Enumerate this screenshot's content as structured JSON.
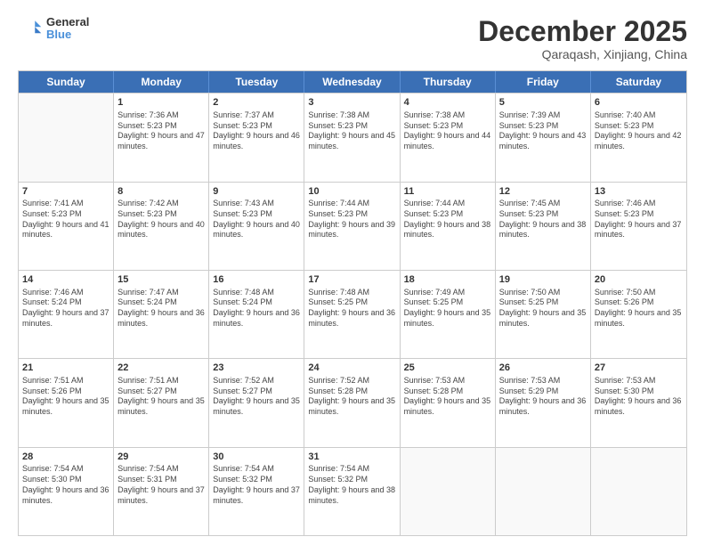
{
  "header": {
    "logo_line1": "General",
    "logo_line2": "Blue",
    "month": "December 2025",
    "location": "Qaraqash, Xinjiang, China"
  },
  "days_of_week": [
    "Sunday",
    "Monday",
    "Tuesday",
    "Wednesday",
    "Thursday",
    "Friday",
    "Saturday"
  ],
  "weeks": [
    [
      {
        "day": "",
        "empty": true
      },
      {
        "day": "1",
        "sunrise": "7:36 AM",
        "sunset": "5:23 PM",
        "daylight": "9 hours and 47 minutes."
      },
      {
        "day": "2",
        "sunrise": "7:37 AM",
        "sunset": "5:23 PM",
        "daylight": "9 hours and 46 minutes."
      },
      {
        "day": "3",
        "sunrise": "7:38 AM",
        "sunset": "5:23 PM",
        "daylight": "9 hours and 45 minutes."
      },
      {
        "day": "4",
        "sunrise": "7:38 AM",
        "sunset": "5:23 PM",
        "daylight": "9 hours and 44 minutes."
      },
      {
        "day": "5",
        "sunrise": "7:39 AM",
        "sunset": "5:23 PM",
        "daylight": "9 hours and 43 minutes."
      },
      {
        "day": "6",
        "sunrise": "7:40 AM",
        "sunset": "5:23 PM",
        "daylight": "9 hours and 42 minutes."
      }
    ],
    [
      {
        "day": "7",
        "sunrise": "7:41 AM",
        "sunset": "5:23 PM",
        "daylight": "9 hours and 41 minutes."
      },
      {
        "day": "8",
        "sunrise": "7:42 AM",
        "sunset": "5:23 PM",
        "daylight": "9 hours and 40 minutes."
      },
      {
        "day": "9",
        "sunrise": "7:43 AM",
        "sunset": "5:23 PM",
        "daylight": "9 hours and 40 minutes."
      },
      {
        "day": "10",
        "sunrise": "7:44 AM",
        "sunset": "5:23 PM",
        "daylight": "9 hours and 39 minutes."
      },
      {
        "day": "11",
        "sunrise": "7:44 AM",
        "sunset": "5:23 PM",
        "daylight": "9 hours and 38 minutes."
      },
      {
        "day": "12",
        "sunrise": "7:45 AM",
        "sunset": "5:23 PM",
        "daylight": "9 hours and 38 minutes."
      },
      {
        "day": "13",
        "sunrise": "7:46 AM",
        "sunset": "5:23 PM",
        "daylight": "9 hours and 37 minutes."
      }
    ],
    [
      {
        "day": "14",
        "sunrise": "7:46 AM",
        "sunset": "5:24 PM",
        "daylight": "9 hours and 37 minutes."
      },
      {
        "day": "15",
        "sunrise": "7:47 AM",
        "sunset": "5:24 PM",
        "daylight": "9 hours and 36 minutes."
      },
      {
        "day": "16",
        "sunrise": "7:48 AM",
        "sunset": "5:24 PM",
        "daylight": "9 hours and 36 minutes."
      },
      {
        "day": "17",
        "sunrise": "7:48 AM",
        "sunset": "5:25 PM",
        "daylight": "9 hours and 36 minutes."
      },
      {
        "day": "18",
        "sunrise": "7:49 AM",
        "sunset": "5:25 PM",
        "daylight": "9 hours and 35 minutes."
      },
      {
        "day": "19",
        "sunrise": "7:50 AM",
        "sunset": "5:25 PM",
        "daylight": "9 hours and 35 minutes."
      },
      {
        "day": "20",
        "sunrise": "7:50 AM",
        "sunset": "5:26 PM",
        "daylight": "9 hours and 35 minutes."
      }
    ],
    [
      {
        "day": "21",
        "sunrise": "7:51 AM",
        "sunset": "5:26 PM",
        "daylight": "9 hours and 35 minutes."
      },
      {
        "day": "22",
        "sunrise": "7:51 AM",
        "sunset": "5:27 PM",
        "daylight": "9 hours and 35 minutes."
      },
      {
        "day": "23",
        "sunrise": "7:52 AM",
        "sunset": "5:27 PM",
        "daylight": "9 hours and 35 minutes."
      },
      {
        "day": "24",
        "sunrise": "7:52 AM",
        "sunset": "5:28 PM",
        "daylight": "9 hours and 35 minutes."
      },
      {
        "day": "25",
        "sunrise": "7:53 AM",
        "sunset": "5:28 PM",
        "daylight": "9 hours and 35 minutes."
      },
      {
        "day": "26",
        "sunrise": "7:53 AM",
        "sunset": "5:29 PM",
        "daylight": "9 hours and 36 minutes."
      },
      {
        "day": "27",
        "sunrise": "7:53 AM",
        "sunset": "5:30 PM",
        "daylight": "9 hours and 36 minutes."
      }
    ],
    [
      {
        "day": "28",
        "sunrise": "7:54 AM",
        "sunset": "5:30 PM",
        "daylight": "9 hours and 36 minutes."
      },
      {
        "day": "29",
        "sunrise": "7:54 AM",
        "sunset": "5:31 PM",
        "daylight": "9 hours and 37 minutes."
      },
      {
        "day": "30",
        "sunrise": "7:54 AM",
        "sunset": "5:32 PM",
        "daylight": "9 hours and 37 minutes."
      },
      {
        "day": "31",
        "sunrise": "7:54 AM",
        "sunset": "5:32 PM",
        "daylight": "9 hours and 38 minutes."
      },
      {
        "day": "",
        "empty": true
      },
      {
        "day": "",
        "empty": true
      },
      {
        "day": "",
        "empty": true
      }
    ]
  ]
}
